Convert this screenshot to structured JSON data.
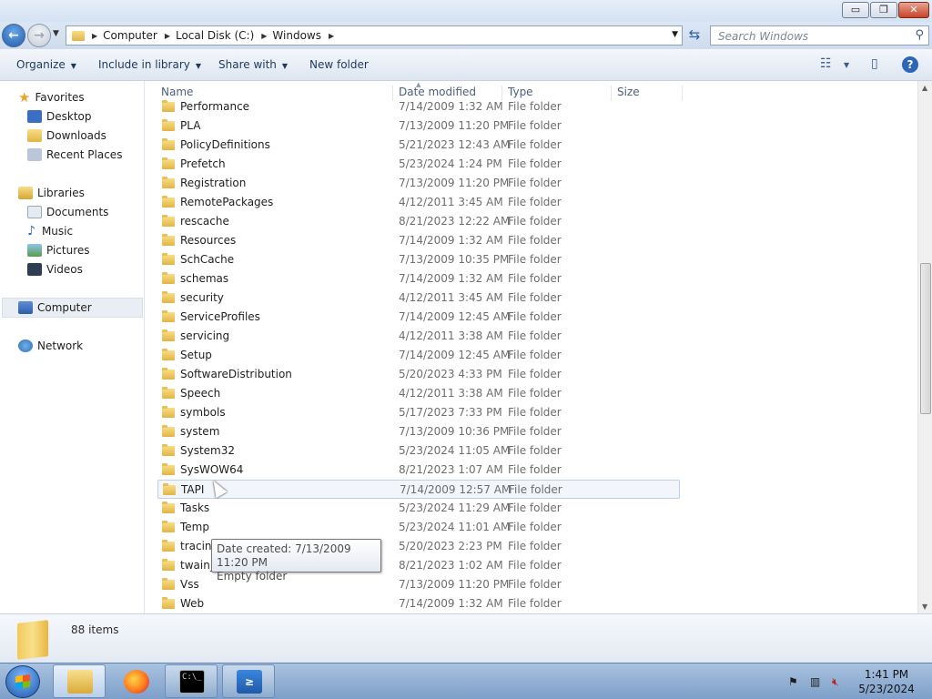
{
  "window": {
    "controls": {
      "minimize": "▭",
      "maximize": "❐",
      "close": "✕"
    }
  },
  "navbar": {
    "address": {
      "segments": [
        "Computer",
        "Local Disk (C:)",
        "Windows"
      ]
    },
    "search_placeholder": "Search Windows"
  },
  "toolbar": {
    "organize": "Organize",
    "include_in_library": "Include in library",
    "share_with": "Share with",
    "new_folder": "New folder"
  },
  "nav_pane": {
    "favorites": {
      "label": "Favorites",
      "items": [
        "Desktop",
        "Downloads",
        "Recent Places"
      ]
    },
    "libraries": {
      "label": "Libraries",
      "items": [
        "Documents",
        "Music",
        "Pictures",
        "Videos"
      ]
    },
    "computer": "Computer",
    "network": "Network"
  },
  "columns": {
    "name": "Name",
    "date_modified": "Date modified",
    "type": "Type",
    "size": "Size"
  },
  "files": [
    {
      "name": "Performance",
      "date": "7/14/2009 1:32 AM",
      "type": "File folder"
    },
    {
      "name": "PLA",
      "date": "7/13/2009 11:20 PM",
      "type": "File folder"
    },
    {
      "name": "PolicyDefinitions",
      "date": "5/21/2023 12:43 AM",
      "type": "File folder"
    },
    {
      "name": "Prefetch",
      "date": "5/23/2024 1:24 PM",
      "type": "File folder"
    },
    {
      "name": "Registration",
      "date": "7/13/2009 11:20 PM",
      "type": "File folder"
    },
    {
      "name": "RemotePackages",
      "date": "4/12/2011 3:45 AM",
      "type": "File folder"
    },
    {
      "name": "rescache",
      "date": "8/21/2023 12:22 AM",
      "type": "File folder"
    },
    {
      "name": "Resources",
      "date": "7/14/2009 1:32 AM",
      "type": "File folder"
    },
    {
      "name": "SchCache",
      "date": "7/13/2009 10:35 PM",
      "type": "File folder"
    },
    {
      "name": "schemas",
      "date": "7/14/2009 1:32 AM",
      "type": "File folder"
    },
    {
      "name": "security",
      "date": "4/12/2011 3:45 AM",
      "type": "File folder"
    },
    {
      "name": "ServiceProfiles",
      "date": "7/14/2009 12:45 AM",
      "type": "File folder"
    },
    {
      "name": "servicing",
      "date": "4/12/2011 3:38 AM",
      "type": "File folder"
    },
    {
      "name": "Setup",
      "date": "7/14/2009 12:45 AM",
      "type": "File folder"
    },
    {
      "name": "SoftwareDistribution",
      "date": "5/20/2023 4:33 PM",
      "type": "File folder"
    },
    {
      "name": "Speech",
      "date": "4/12/2011 3:38 AM",
      "type": "File folder"
    },
    {
      "name": "symbols",
      "date": "5/17/2023 7:33 PM",
      "type": "File folder"
    },
    {
      "name": "system",
      "date": "7/13/2009 10:36 PM",
      "type": "File folder"
    },
    {
      "name": "System32",
      "date": "5/23/2024 11:05 AM",
      "type": "File folder"
    },
    {
      "name": "SysWOW64",
      "date": "8/21/2023 1:07 AM",
      "type": "File folder"
    },
    {
      "name": "TAPI",
      "date": "7/14/2009 12:57 AM",
      "type": "File folder",
      "hover": true
    },
    {
      "name": "Tasks",
      "date": "5/23/2024 11:29 AM",
      "type": "File folder"
    },
    {
      "name": "Temp",
      "date": "5/23/2024 11:01 AM",
      "type": "File folder"
    },
    {
      "name": "tracing",
      "date": "5/20/2023 2:23 PM",
      "type": "File folder"
    },
    {
      "name": "twain_32",
      "date": "8/21/2023 1:02 AM",
      "type": "File folder"
    },
    {
      "name": "Vss",
      "date": "7/13/2009 11:20 PM",
      "type": "File folder"
    },
    {
      "name": "Web",
      "date": "7/14/2009 1:32 AM",
      "type": "File folder"
    }
  ],
  "tooltip": {
    "line1": "Date created: 7/13/2009 11:20 PM",
    "line2": "Empty folder"
  },
  "details_pane": {
    "item_count": "88 items"
  },
  "taskbar": {
    "pinned": [
      {
        "icon": "file-explorer-icon",
        "color": "#e8c05a"
      },
      {
        "icon": "firefox-icon",
        "color": "#e66000"
      },
      {
        "icon": "command-prompt-icon",
        "color": "#000000"
      },
      {
        "icon": "powershell-icon",
        "color": "#2a6fc9"
      }
    ],
    "clock": {
      "time": "1:41 PM",
      "date": "5/23/2024"
    }
  }
}
